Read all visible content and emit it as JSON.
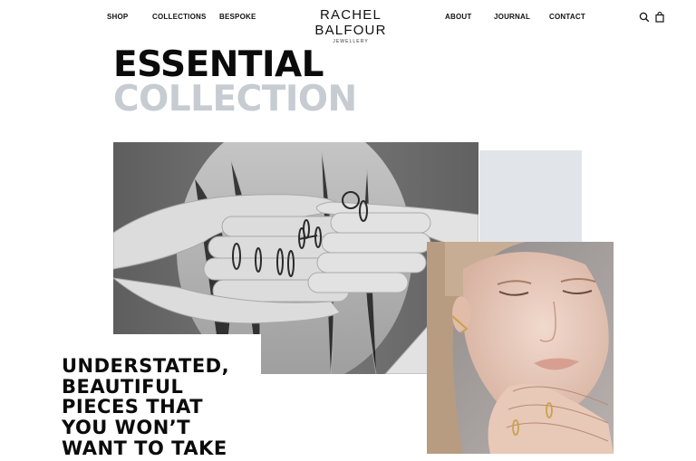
{
  "nav": {
    "left": [
      "SHOP",
      "COLLECTIONS",
      "BESPOKE"
    ],
    "right": [
      "ABOUT",
      "JOURNAL",
      "CONTACT"
    ]
  },
  "brand": {
    "name": "RACHEL BALFOUR",
    "subtitle": "JEWELLERY"
  },
  "icons": {
    "search": "search-icon",
    "bag": "shopping-bag-icon"
  },
  "hero": {
    "title_line1": "ESSENTIAL",
    "title_line2": "COLLECTION",
    "title_color": "#0b0b0b",
    "subtitle_color": "#c6ccd2",
    "accent_block_color": "#e1e5ea"
  },
  "tagline": {
    "lines": [
      "UNDERSTATED,",
      "BEAUTIFUL",
      "PIECES THAT",
      "YOU WON’T",
      "WANT TO TAKE"
    ]
  }
}
